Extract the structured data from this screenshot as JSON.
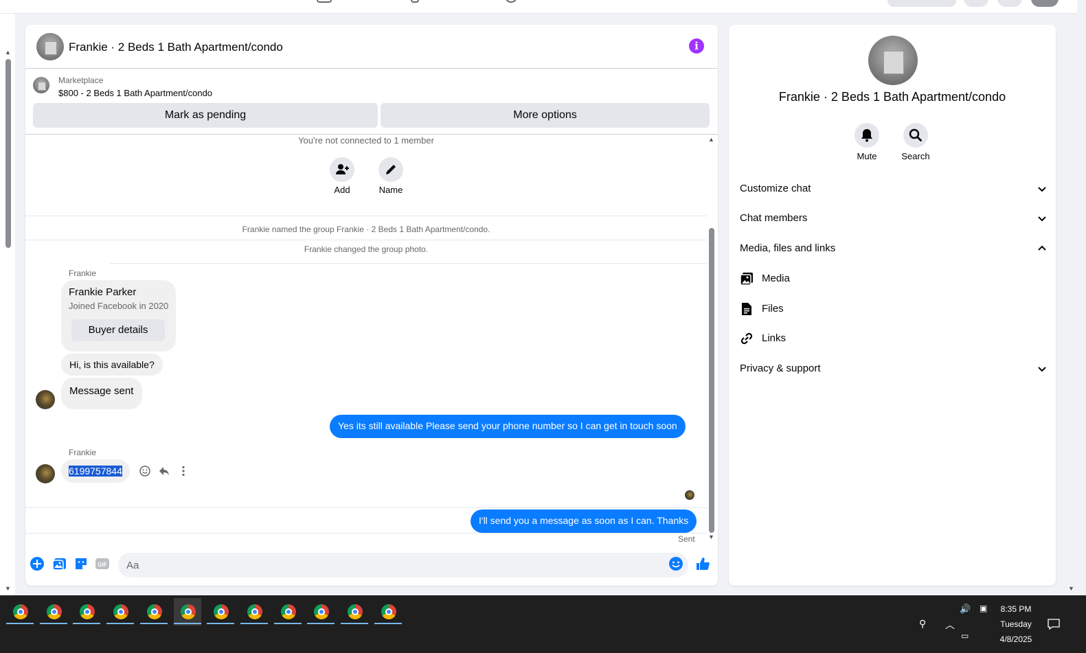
{
  "chat": {
    "title": "Frankie · 2 Beds 1 Bath Apartment/condo",
    "marketplace_label": "Marketplace",
    "marketplace_item": "$800 - 2 Beds 1 Bath Apartment/condo",
    "mark_pending_label": "Mark as pending",
    "more_options_label": "More options",
    "not_connected": "You're not connected to 1 member",
    "add_label": "Add",
    "name_label": "Name",
    "note_named": "Frankie named the group Frankie · 2 Beds 1 Bath Apartment/condo.",
    "note_photo": "Frankie changed the group photo.",
    "sender_1": "Frankie",
    "profile_name": "Frankie Parker",
    "profile_joined": "Joined Facebook in 2020",
    "buyer_details_label": "Buyer details",
    "msg_available": "Hi, is this available?",
    "msg_sent_card": "Message sent",
    "msg_reply_1": "Yes its still available Please send your phone number so I can get in touch soon",
    "sender_2": "Frankie",
    "msg_phone": "6199757844",
    "msg_reply_2": "I'll send you a message as soon as I can. Thanks",
    "status_sent": "Sent",
    "composer_placeholder": "Aa"
  },
  "info_panel": {
    "title": "Frankie · 2 Beds 1 Bath Apartment/condo",
    "mute_label": "Mute",
    "search_label": "Search",
    "sections": {
      "customize": "Customize chat",
      "members": "Chat members",
      "media_files_links": "Media, files and links",
      "media": "Media",
      "files": "Files",
      "links": "Links",
      "privacy": "Privacy & support"
    }
  },
  "taskbar": {
    "time": "8:35 PM",
    "day": "Tuesday",
    "date": "4/8/2025",
    "app_count": 12
  },
  "colors": {
    "accent_blue": "#0a7cff",
    "info_purple": "#a033ff",
    "gray_button": "#e4e6eb"
  }
}
